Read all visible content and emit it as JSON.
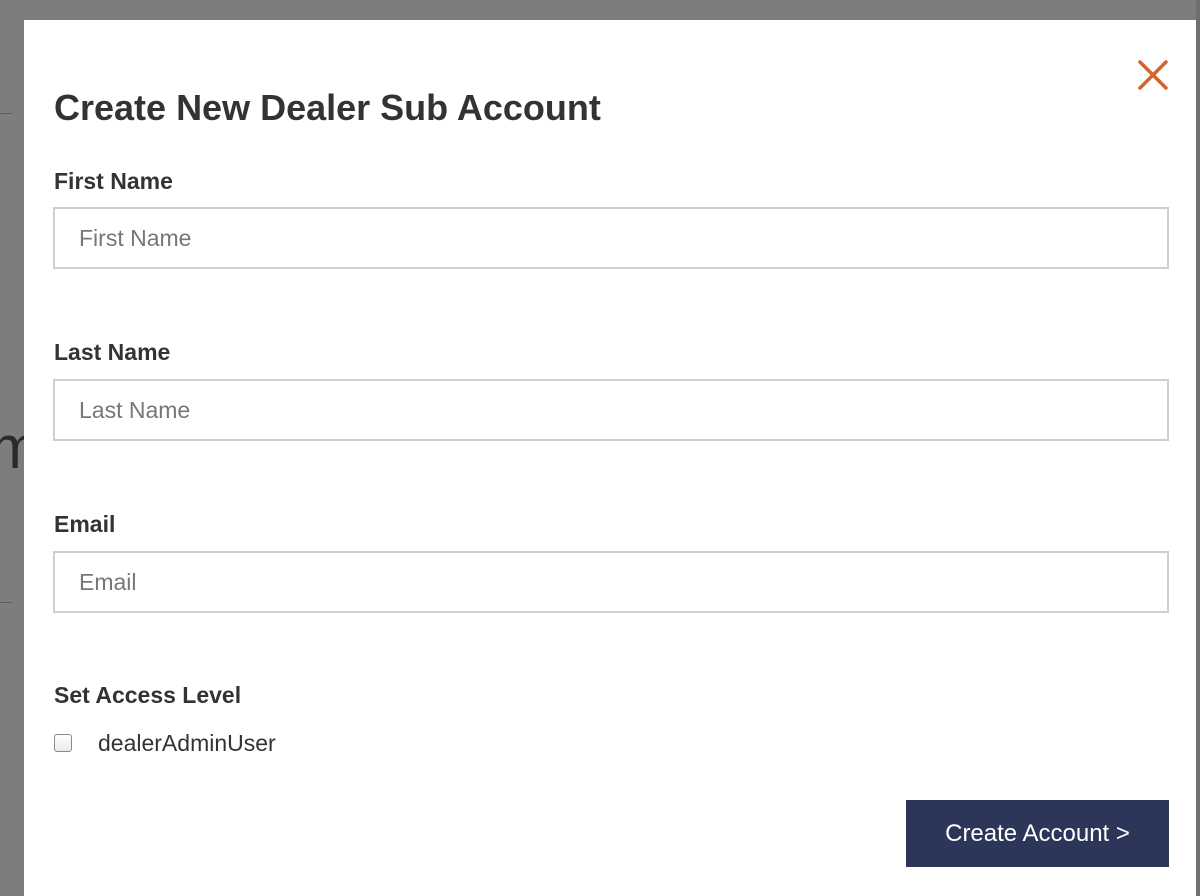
{
  "modal": {
    "title": "Create New Dealer Sub Account",
    "close_icon": "close-icon",
    "accent_color": "#d2642c",
    "fields": {
      "first_name": {
        "label": "First Name",
        "placeholder": "First Name",
        "value": ""
      },
      "last_name": {
        "label": "Last Name",
        "placeholder": "Last Name",
        "value": ""
      },
      "email": {
        "label": "Email",
        "placeholder": "Email",
        "value": ""
      }
    },
    "access": {
      "label": "Set Access Level",
      "options": [
        {
          "label": "dealerAdminUser",
          "checked": false
        }
      ]
    },
    "submit_label": "Create Account >",
    "submit_color": "#2c3658"
  }
}
